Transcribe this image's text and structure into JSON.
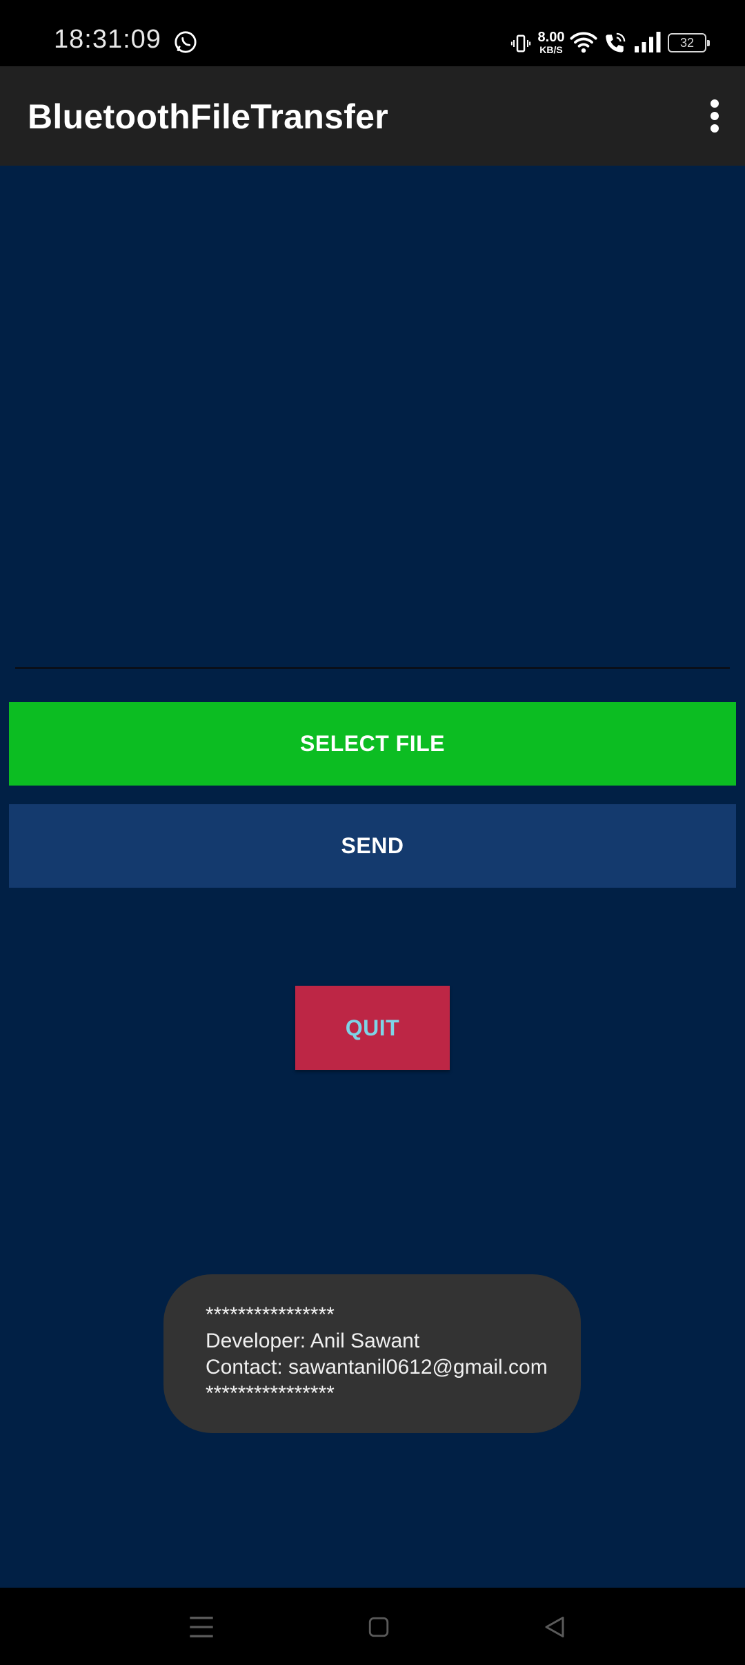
{
  "status_bar": {
    "time": "18:31:09",
    "net_speed_value": "8.00",
    "net_speed_unit": "KB/S",
    "battery_level": "32",
    "icons": [
      "whatsapp-icon",
      "vibrate-icon",
      "wifi-icon",
      "wifi-calling-icon",
      "signal-icon",
      "battery-icon"
    ]
  },
  "app_bar": {
    "title": "BluetoothFileTransfer",
    "menu_icon": "more-vert-icon"
  },
  "main": {
    "select_file_label": "SELECT FILE",
    "send_label": "SEND",
    "quit_label": "QUIT"
  },
  "toast": {
    "line1": "****************",
    "line2": "Developer: Anil Sawant",
    "line3": "Contact: sawantanil0612@gmail.com",
    "line4": "****************"
  },
  "nav_bar": {
    "icons": [
      "menu-icon",
      "home-icon",
      "back-icon"
    ]
  },
  "colors": {
    "background": "#012045",
    "app_bar": "#212121",
    "select_button": "#0cbd22",
    "send_button": "#143a6e",
    "quit_button": "#bd2645",
    "quit_text": "#7ed3e6",
    "toast": "#333333"
  }
}
